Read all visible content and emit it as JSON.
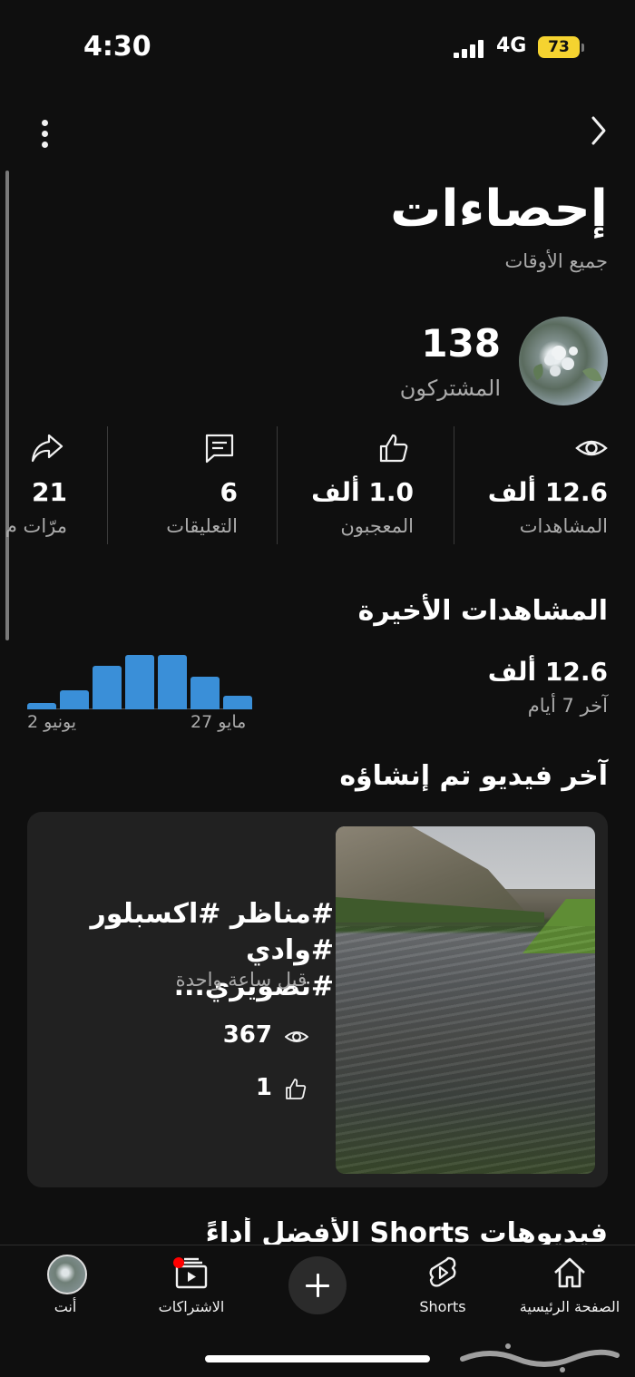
{
  "status": {
    "time": "4:30",
    "network": "4G",
    "battery": "73"
  },
  "header": {
    "title": "إحصاءات",
    "subtitle": "جميع الأوقات"
  },
  "channel": {
    "subscribers": "138",
    "subscribers_label": "المشتركون"
  },
  "stats": {
    "views": {
      "value": "12.6 ألف",
      "label": "المشاهدات",
      "icon": "eye-icon"
    },
    "likes": {
      "value": "1.0 ألف",
      "label": "المعجبون",
      "icon": "thumbs-up-icon"
    },
    "comments": {
      "value": "6",
      "label": "التعليقات",
      "icon": "comment-icon"
    },
    "shares": {
      "value": "21",
      "label": "مرّات م",
      "icon": "share-icon"
    }
  },
  "recent": {
    "title": "المشاهدات الأخيرة",
    "value": "12.6 ألف",
    "period": "آخر 7 أيام"
  },
  "chart_data": {
    "type": "bar",
    "categories": [
      "27 مايو",
      "",
      "",
      "",
      "",
      "",
      "2 يونيو"
    ],
    "values": [
      0.5,
      1.2,
      2.0,
      2.0,
      1.6,
      0.7,
      0.23
    ],
    "ylim": [
      0,
      2.0
    ],
    "tick_labels": [
      "27 مايو",
      "2 يونيو"
    ],
    "bar_color": "#3a8fd8",
    "grid": false
  },
  "latest_video": {
    "section_title": "آخر فيديو تم إنشاؤه",
    "title": "#مناظر #اكسبلور #وادي #تصويري...",
    "published": "قبل ساعة واحدة",
    "views": "367",
    "likes": "1"
  },
  "top_shorts": {
    "title": "فيديوهات Shorts الأفضل أداءً"
  },
  "tabs": [
    {
      "label": "الصفحة الرئيسية",
      "icon": "home-icon"
    },
    {
      "label": "Shorts",
      "icon": "shorts-icon"
    },
    {
      "label": "",
      "icon": "plus-icon"
    },
    {
      "label": "الاشتراكات",
      "icon": "subscriptions-icon"
    },
    {
      "label": "أنت",
      "icon": "avatar"
    }
  ],
  "colors": {
    "background": "#0f0f0f",
    "card": "#212121",
    "accent_bar": "#3a8fd8",
    "battery": "#f5d330",
    "notification": "#ff0000"
  },
  "watermark": "حراج"
}
